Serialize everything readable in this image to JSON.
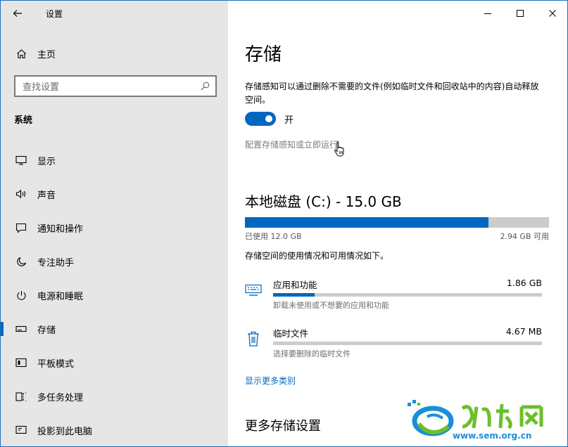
{
  "window": {
    "app_title": "设置",
    "caption": {
      "minimize": "minimize-icon",
      "maximize": "maximize-icon",
      "close": "close-icon"
    }
  },
  "sidebar": {
    "home_label": "主页",
    "search_placeholder": "查找设置",
    "section_title": "系统",
    "items": [
      {
        "label": "显示",
        "icon": "display-icon"
      },
      {
        "label": "声音",
        "icon": "speaker-icon"
      },
      {
        "label": "通知和操作",
        "icon": "notification-icon"
      },
      {
        "label": "专注助手",
        "icon": "moon-icon"
      },
      {
        "label": "电源和睡眠",
        "icon": "power-icon"
      },
      {
        "label": "存储",
        "icon": "storage-icon",
        "selected": true
      },
      {
        "label": "平板模式",
        "icon": "tablet-icon"
      },
      {
        "label": "多任务处理",
        "icon": "multitask-icon"
      },
      {
        "label": "投影到此电脑",
        "icon": "project-icon"
      }
    ]
  },
  "main": {
    "title": "存储",
    "description": "存储感知可以通过删除不需要的文件(例如临时文件和回收站中的内容)自动释放空间。",
    "toggle_state": "开",
    "toggle_on": true,
    "config_link": "配置存储感知或立即运行",
    "disk": {
      "title": "本地磁盘 (C:) - 15.0 GB",
      "used_label": "已使用 12.0 GB",
      "free_label": "2.94 GB 可用",
      "used_fraction": 0.8
    },
    "usage_description": "存储空间的使用情况和可用情况如下。",
    "categories": [
      {
        "name": "应用和功能",
        "size": "1.86 GB",
        "subtitle": "卸载未使用或不想要的应用和功能",
        "fraction": 0.155,
        "icon": "keyboard-icon"
      },
      {
        "name": "临时文件",
        "size": "4.67 MB",
        "subtitle": "选择要删除的临时文件",
        "fraction": 0.0,
        "icon": "trash-icon"
      }
    ],
    "more_categories_link": "显示更多类别",
    "more_settings_heading": "更多存储设置"
  },
  "watermark": {
    "url_text": "www.sem.org.cn"
  },
  "colors": {
    "accent": "#0067c0",
    "sidebar_bg": "#e6e6e6",
    "bar_track": "#cccccc"
  }
}
